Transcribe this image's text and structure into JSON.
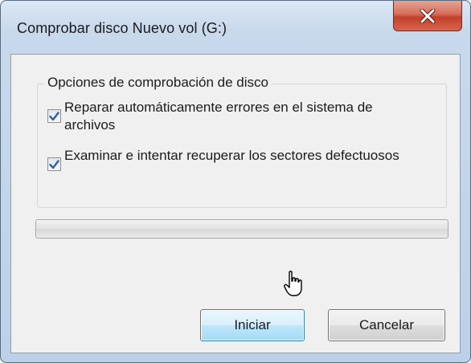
{
  "window": {
    "title": "Comprobar disco Nuevo vol (G:)",
    "close_icon": "close-icon"
  },
  "options_group": {
    "legend": "Opciones de comprobación de disco",
    "options": [
      {
        "label": "Reparar automáticamente errores en el sistema de archivos",
        "checked": true
      },
      {
        "label": "Examinar e intentar recuperar los sectores defectuosos",
        "checked": true
      }
    ]
  },
  "progress": {
    "value": 0
  },
  "buttons": {
    "start_label": "Iniciar",
    "cancel_label": "Cancelar"
  },
  "colors": {
    "close_button": "#c2402a",
    "default_button_border": "#3c7fb1",
    "check_mark": "#2f5fa8"
  }
}
